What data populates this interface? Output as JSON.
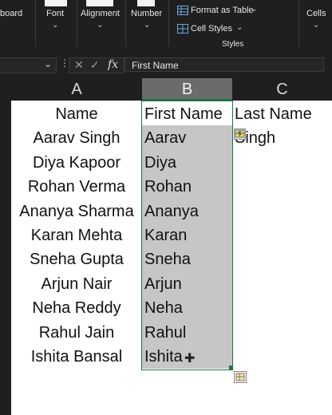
{
  "ribbon": {
    "groups": [
      {
        "label": "board"
      },
      {
        "label": "Font"
      },
      {
        "label": "Alignment"
      },
      {
        "label": "Number"
      }
    ],
    "styles": {
      "format_as_table": "Format as Table",
      "cell_styles": "Cell Styles",
      "group_label": "Styles"
    },
    "cells_label": "Cells"
  },
  "formula_bar": {
    "fx": "fx",
    "value": "First Name"
  },
  "columns": [
    "A",
    "B",
    "C"
  ],
  "rows": [
    {
      "a": "Name",
      "b": "First Name",
      "c": "Last Name"
    },
    {
      "a": "Aarav Singh",
      "b": "Aarav",
      "c": "Singh"
    },
    {
      "a": "Diya Kapoor",
      "b": "Diya",
      "c": ""
    },
    {
      "a": "Rohan Verma",
      "b": "Rohan",
      "c": ""
    },
    {
      "a": "Ananya Sharma",
      "b": "Ananya",
      "c": ""
    },
    {
      "a": "Karan Mehta",
      "b": "Karan",
      "c": ""
    },
    {
      "a": "Sneha Gupta",
      "b": "Sneha",
      "c": ""
    },
    {
      "a": "Arjun Nair",
      "b": "Arjun",
      "c": ""
    },
    {
      "a": "Neha Reddy",
      "b": "Neha",
      "c": ""
    },
    {
      "a": "Rahul Jain",
      "b": "Rahul",
      "c": ""
    },
    {
      "a": "Ishita Bansal",
      "b": "Ishita",
      "c": ""
    }
  ],
  "colors": {
    "selection_fill": "#c6c6c6",
    "selection_border": "#1e7145",
    "header_selected": "#6b6b6b"
  }
}
